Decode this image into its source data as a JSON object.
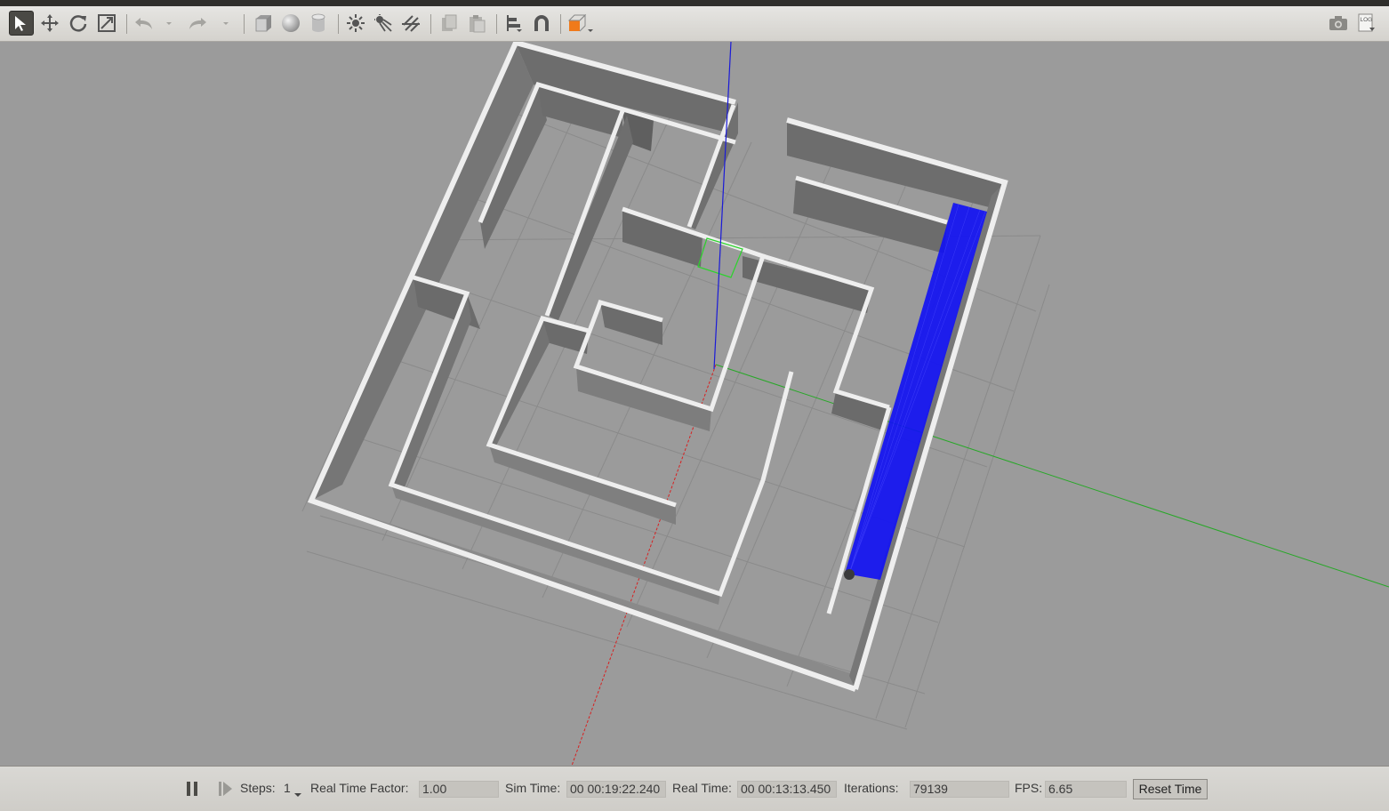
{
  "toolbar": {
    "tools": [
      {
        "name": "select-mode-icon",
        "active": true
      },
      {
        "name": "translate-mode-icon"
      },
      {
        "name": "rotate-mode-icon"
      },
      {
        "name": "scale-mode-icon"
      },
      {
        "name": "undo-icon"
      },
      {
        "name": "redo-icon"
      },
      {
        "name": "box-shape-icon"
      },
      {
        "name": "sphere-shape-icon"
      },
      {
        "name": "cylinder-shape-icon"
      },
      {
        "name": "point-light-icon"
      },
      {
        "name": "spot-light-icon"
      },
      {
        "name": "directional-light-icon"
      },
      {
        "name": "copy-icon"
      },
      {
        "name": "paste-icon"
      },
      {
        "name": "align-icon"
      },
      {
        "name": "snap-icon"
      },
      {
        "name": "view-angle-icon"
      },
      {
        "name": "screenshot-icon"
      },
      {
        "name": "log-icon"
      }
    ],
    "log_text": "LOG"
  },
  "bottombar": {
    "steps_label": "Steps:",
    "steps_value": "1",
    "rtf_label": "Real Time Factor:",
    "rtf_value": "1.00",
    "sim_time_label": "Sim Time:",
    "sim_time_value": "00 00:19:22.240",
    "real_time_label": "Real Time:",
    "real_time_value": "00 00:13:13.450",
    "iterations_label": "Iterations:",
    "iterations_value": "79139",
    "fps_label": "FPS:",
    "fps_value": "6.65",
    "reset_label": "Reset Time"
  },
  "colors": {
    "background": "#9b9b9b",
    "wall_top": "#eeeeee",
    "wall_side": "#6f6f6f",
    "laser": "#0000ff",
    "selection": "#00ff00",
    "x_axis": "#ff0000",
    "y_axis": "#00ff00",
    "z_axis": "#0000ff",
    "accent": "#f07a1a"
  }
}
